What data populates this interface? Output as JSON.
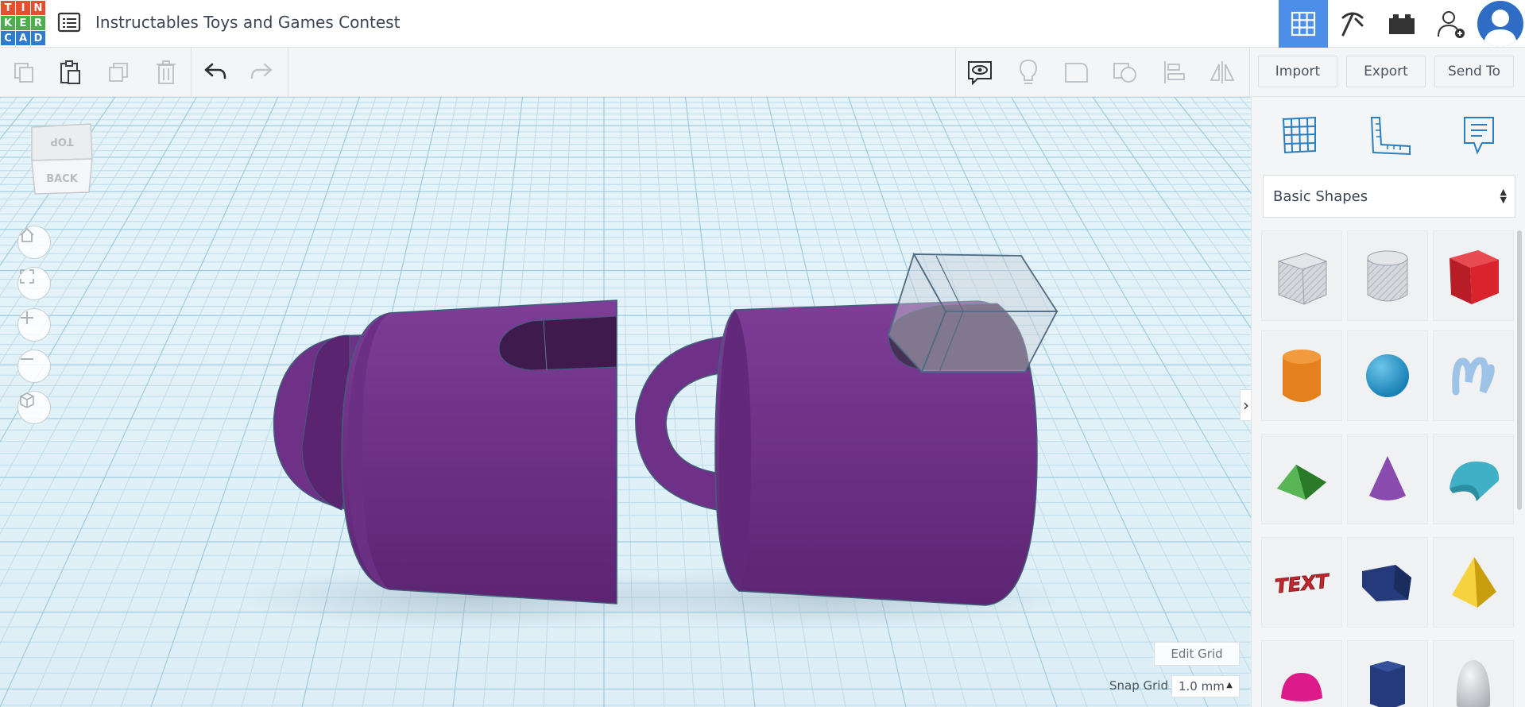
{
  "app": {
    "logo_letters": [
      "T",
      "I",
      "N",
      "K",
      "E",
      "R",
      "C",
      "A",
      "D"
    ],
    "logo_colors": [
      "#e2502f",
      "#e2502f",
      "#e2502f",
      "#4cae4f",
      "#4cae4f",
      "#4cae4f",
      "#2f7bce",
      "#2f7bce",
      "#2f7bce"
    ],
    "title": "Instructables Toys and Games Contest"
  },
  "header": {
    "view_buttons": [
      "3d-design-icon",
      "codeblocks-icon",
      "bricks-icon",
      "invite-user-icon",
      "user-avatar-icon"
    ],
    "active_view": "3d-design-icon",
    "accent": "#4d8ee9"
  },
  "toolbar": {
    "actions": [
      "copy",
      "paste",
      "duplicate",
      "delete",
      "undo",
      "redo"
    ],
    "view_tools": [
      "show-all-notes",
      "light-bulb",
      "group",
      "ungroup",
      "align",
      "mirror"
    ],
    "import_label": "Import",
    "export_label": "Export",
    "send_to_label": "Send To"
  },
  "viewport": {
    "viewcube_top": "TOP",
    "viewcube_back": "BACK",
    "nav_buttons": [
      "home-view-icon",
      "fit-view-icon",
      "zoom-in-icon",
      "zoom-out-icon",
      "perspective-icon"
    ],
    "edit_grid_label": "Edit Grid",
    "snap_grid_label": "Snap Grid",
    "snap_grid_value": "1.0 mm",
    "shape_color": "#7a3c93",
    "hole_color": "#c9ced6"
  },
  "panel": {
    "tabs": [
      "workplane-icon",
      "ruler-icon",
      "notes-icon"
    ],
    "category": "Basic Shapes",
    "shapes": [
      {
        "name": "Box Hole",
        "color": "#c4c8ce"
      },
      {
        "name": "Cylinder Hole",
        "color": "#c4c8ce"
      },
      {
        "name": "Box",
        "color": "#d9232d"
      },
      {
        "name": "Cylinder",
        "color": "#e5811d"
      },
      {
        "name": "Sphere",
        "color": "#2a9ad0"
      },
      {
        "name": "Scribble",
        "color": "#9ec3e6"
      },
      {
        "name": "Roof",
        "color": "#3d9a3a"
      },
      {
        "name": "Cone",
        "color": "#8a4bae"
      },
      {
        "name": "Round Roof",
        "color": "#3fb0c5"
      },
      {
        "name": "Text",
        "color": "#c0282e"
      },
      {
        "name": "Wedge",
        "color": "#243a7a"
      },
      {
        "name": "Pyramid",
        "color": "#eac014"
      },
      {
        "name": "Half Sphere",
        "color": "#dd1a8a"
      },
      {
        "name": "Polygon",
        "color": "#243a7a"
      },
      {
        "name": "Paraboloid",
        "color": "#d2d4d8"
      }
    ]
  }
}
